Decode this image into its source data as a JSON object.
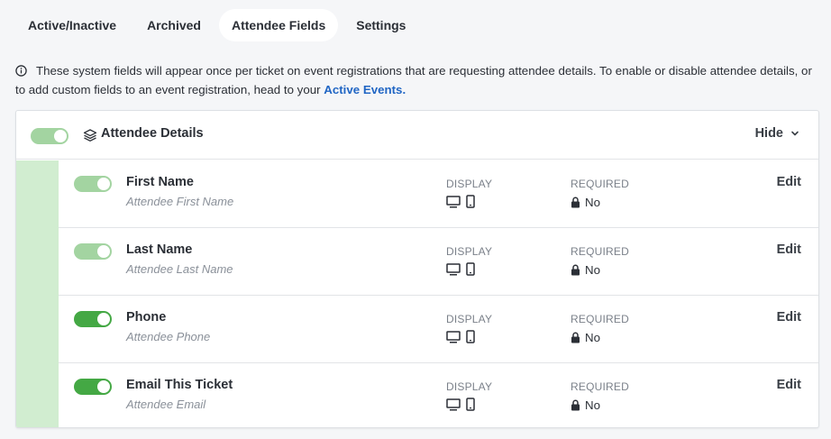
{
  "tabs": [
    {
      "label": "Active/Inactive",
      "active": false
    },
    {
      "label": "Archived",
      "active": false
    },
    {
      "label": "Attendee Fields",
      "active": true
    },
    {
      "label": "Settings",
      "active": false
    }
  ],
  "info": {
    "icon": "info-icon",
    "text": "These system fields will appear once per ticket on event registrations that are requesting attendee details. To enable or disable attendee details, or to add custom fields to an event registration, head to your ",
    "link_label": "Active Events."
  },
  "section": {
    "title": "Attendee Details",
    "icon": "layers-icon",
    "hide_label": "Hide",
    "toggle_state": "on-disabled"
  },
  "columns": {
    "display": "DISPLAY",
    "required": "REQUIRED"
  },
  "fields": [
    {
      "name": "First Name",
      "sublabel": "Attendee First Name",
      "required_value": "No",
      "edit_label": "Edit",
      "toggle_state": "on-disabled"
    },
    {
      "name": "Last Name",
      "sublabel": "Attendee Last Name",
      "required_value": "No",
      "edit_label": "Edit",
      "toggle_state": "on-disabled"
    },
    {
      "name": "Phone",
      "sublabel": "Attendee Phone",
      "required_value": "No",
      "edit_label": "Edit",
      "toggle_state": "on"
    },
    {
      "name": "Email This Ticket",
      "sublabel": "Attendee Email",
      "required_value": "No",
      "edit_label": "Edit",
      "toggle_state": "on"
    }
  ],
  "colors": {
    "toggle_on": "#44a844",
    "toggle_disabled": "#a3d4a1",
    "side_strip": "#d1edd0",
    "link": "#2166c4"
  }
}
